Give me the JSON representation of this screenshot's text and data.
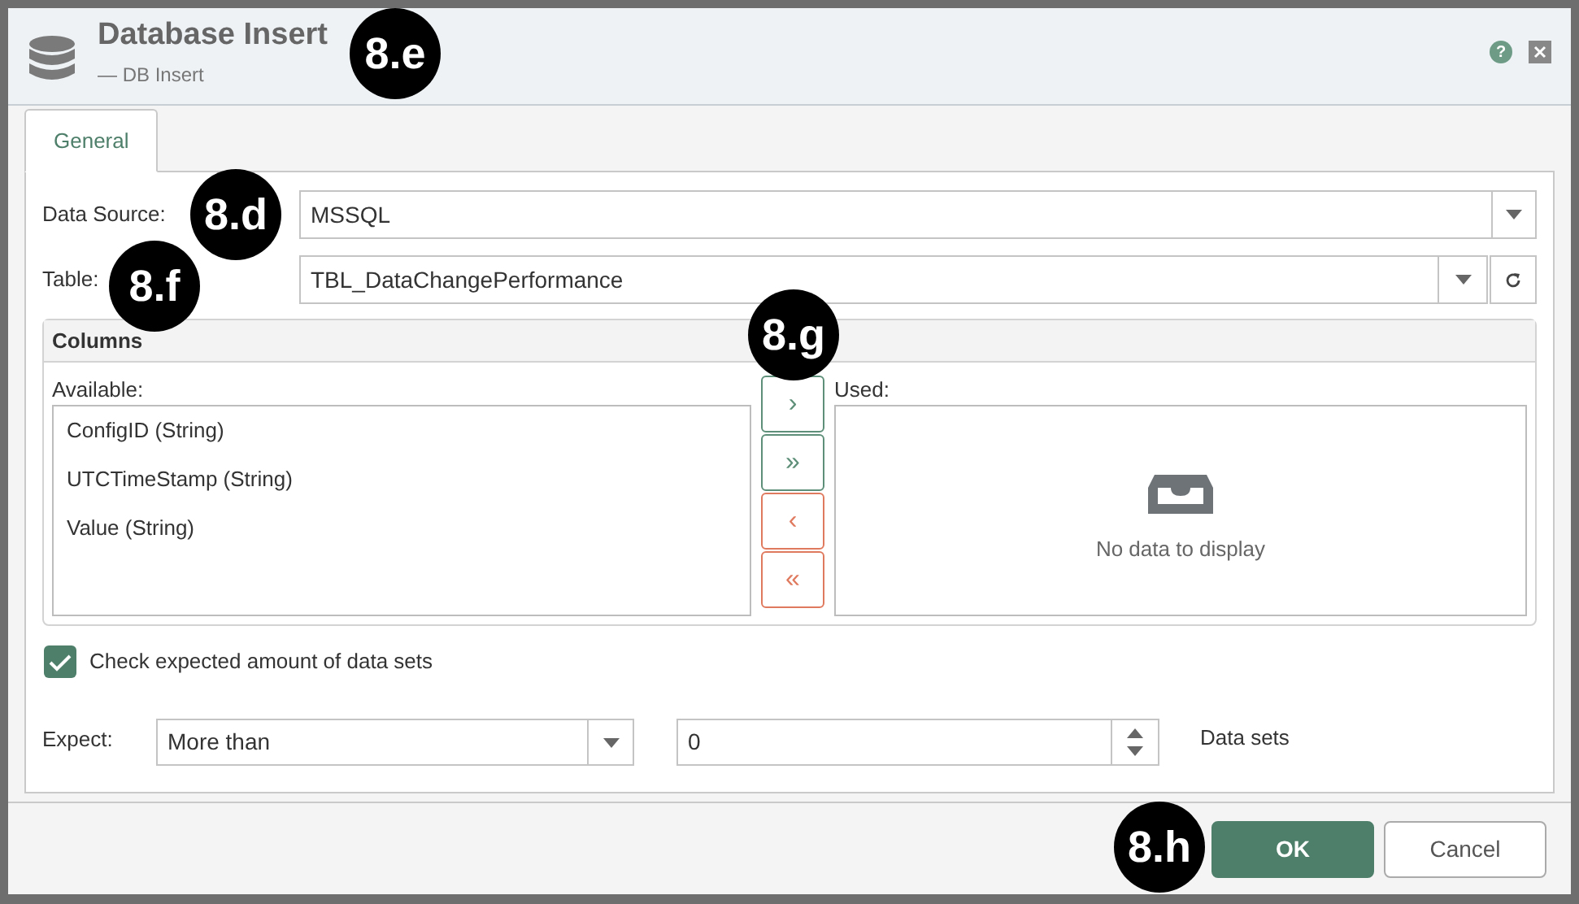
{
  "window": {
    "title": "Database Insert",
    "subtitle": "— DB Insert",
    "help": "?"
  },
  "tabs": [
    {
      "label": "General",
      "selected": true
    }
  ],
  "data_source": {
    "label": "Data Source:",
    "value": "MSSQL"
  },
  "table": {
    "label": "Table:",
    "value": "TBL_DataChangePerformance"
  },
  "columns": {
    "title": "Columns",
    "available_label": "Available:",
    "used_label": "Used:",
    "available": [
      {
        "label": "ConfigID (String)"
      },
      {
        "label": "UTCTimeStamp (String)"
      },
      {
        "label": "Value (String)"
      }
    ],
    "used_empty": "No data to display",
    "transfer_buttons": [
      {
        "glyph": "›",
        "kind": "add"
      },
      {
        "glyph": "»",
        "kind": "add"
      },
      {
        "glyph": "‹",
        "kind": "remove"
      },
      {
        "glyph": "«",
        "kind": "remove"
      }
    ]
  },
  "check_amount": {
    "label": "Check expected amount of data sets",
    "checked": true
  },
  "expect": {
    "label": "Expect:",
    "mode": "More than",
    "count": "0",
    "unit": "Data sets"
  },
  "buttons": [
    {
      "label": "OK",
      "kind": "primary"
    },
    {
      "label": "Cancel",
      "kind": "secondary"
    }
  ],
  "callouts": [
    {
      "text": "8.e"
    },
    {
      "text": "8.d"
    },
    {
      "text": "8.f"
    },
    {
      "text": "8.g"
    },
    {
      "text": "8.h"
    }
  ]
}
